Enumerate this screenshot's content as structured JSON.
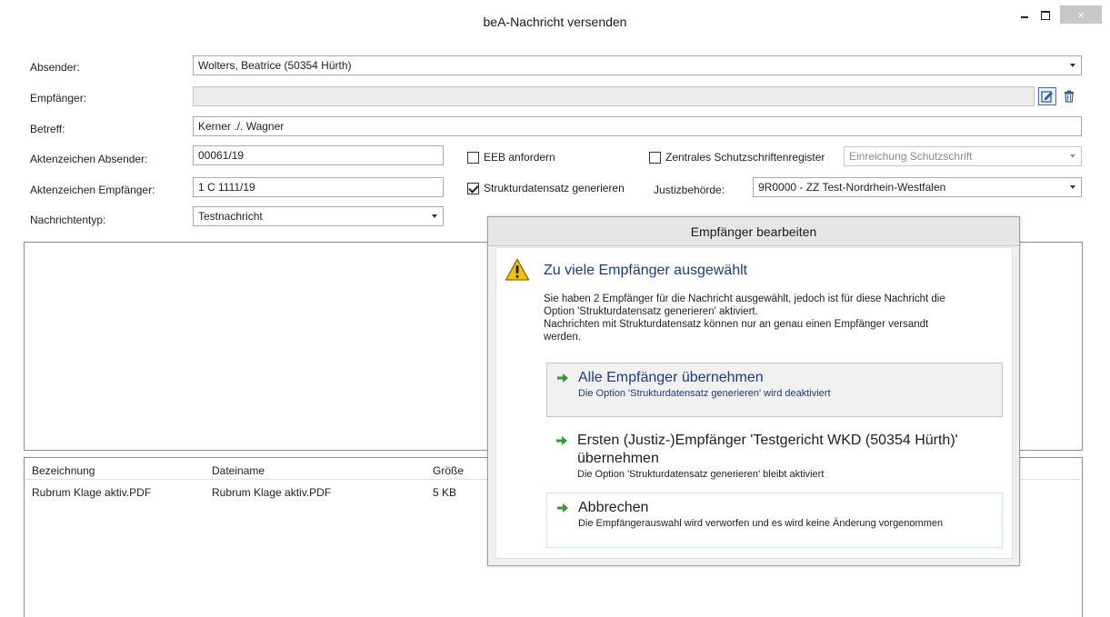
{
  "window": {
    "title": "beA-Nachricht versenden",
    "close_label": "×"
  },
  "form": {
    "sender_label": "Absender:",
    "sender_value": "Wolters, Beatrice (50354 Hürth)",
    "recipient_label": "Empfänger:",
    "recipient_value": "",
    "subject_label": "Betreff:",
    "subject_value": "Kerner ./. Wagner",
    "sender_ref_label": "Aktenzeichen Absender:",
    "sender_ref_value": "00061/19",
    "recipient_ref_label": "Aktenzeichen Empfänger:",
    "recipient_ref_value": "1 C 1111/19",
    "message_type_label": "Nachrichtentyp:",
    "message_type_value": "Testnachricht",
    "eeb_label": "EEB anfordern",
    "eeb_checked": false,
    "struct_label": "Strukturdatensatz generieren",
    "struct_checked": true,
    "register_label": "Zentrales Schutzschriftenregister",
    "register_checked": false,
    "register_select_value": "Einreichung Schutzschrift",
    "authority_label": "Justizbehörde:",
    "authority_value": "9R0000 - ZZ Test-Nordrhein-Westfalen"
  },
  "attachments": {
    "columns": [
      "Bezeichnung",
      "Dateiname",
      "Größe"
    ],
    "rows": [
      [
        "Rubrum Klage aktiv.PDF",
        "Rubrum Klage aktiv.PDF",
        "5 KB"
      ]
    ]
  },
  "dialog": {
    "title": "Empfänger bearbeiten",
    "heading": "Zu viele Empfänger ausgewählt",
    "message_lines": [
      "Sie haben 2 Empfänger für die Nachricht ausgewählt, jedoch ist für diese Nachricht die",
      "Option 'Strukturdatensatz generieren' aktiviert.",
      "Nachrichten mit Strukturdatensatz können nur an genau einen Empfänger versandt",
      "werden."
    ],
    "options": [
      {
        "main": "Alle Empfänger übernehmen",
        "sub": "Die Option 'Strukturdatensatz generieren' wird deaktiviert"
      },
      {
        "main_line1": "Ersten (Justiz-)Empfänger 'Testgericht WKD (50354 Hürth)'",
        "main_line2": "übernehmen",
        "sub": "Die Option 'Strukturdatensatz generieren' bleibt aktiviert"
      },
      {
        "main": "Abbrechen",
        "sub": "Die Empfängerauswahl wird verworfen und es wird keine Änderung vorgenommen"
      }
    ]
  },
  "colors": {
    "accent": "#1c3a8c",
    "arrow_green": "#2e9e2e"
  }
}
